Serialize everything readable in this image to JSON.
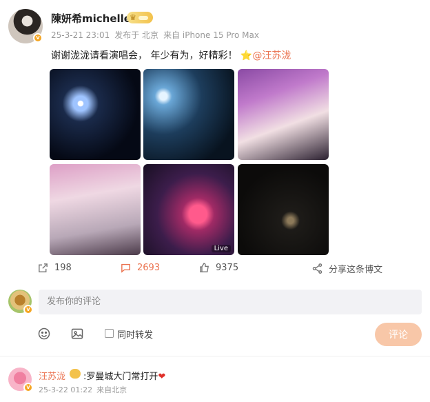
{
  "post": {
    "author": "陳妍希michelle",
    "date": "25-3-21 23:01",
    "source": "发布于 北京",
    "device": "来自 iPhone 15 Pro Max",
    "text_main": "谢谢泷泷请看演唱会，  年少有为，好精彩！",
    "text_star": "⭐",
    "mention": "@汪苏泷",
    "live_label": "Live"
  },
  "actions": {
    "share_count": "198",
    "comment_count": "2693",
    "like_count": "9375",
    "share_friends_label": "分享这条博文"
  },
  "composer": {
    "placeholder": "发布你的评论",
    "repost_label": "同时转发",
    "submit_label": "评论"
  },
  "reply": {
    "author": "汪苏泷",
    "text": ":罗曼城大门常打开",
    "heart": "❤",
    "date": "25-3-22 01:22",
    "location": "来自北京"
  },
  "colors": {
    "accent": "#eb7350",
    "submit_bg": "#f8c7a8",
    "badge": "#f5a623"
  },
  "icons": [
    "share-icon",
    "comment-icon",
    "like-icon",
    "share-friends-icon",
    "emoji-icon",
    "image-icon",
    "crown-icon",
    "verified-icon"
  ]
}
